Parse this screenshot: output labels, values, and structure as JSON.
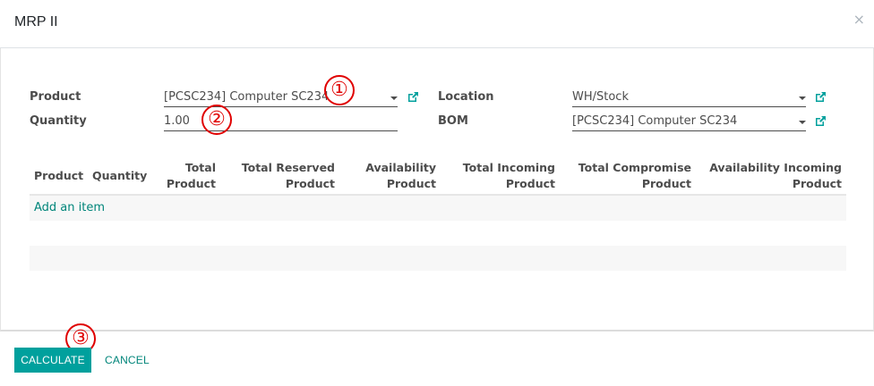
{
  "dialog": {
    "title": "MRP II",
    "close_glyph": "×"
  },
  "form": {
    "product_label": "Product",
    "product_value": "[PCSC234] Computer SC234",
    "quantity_label": "Quantity",
    "quantity_value": "1.00",
    "location_label": "Location",
    "location_value": "WH/Stock",
    "bom_label": "BOM",
    "bom_value": "[PCSC234] Computer SC234"
  },
  "table": {
    "columns": [
      {
        "line1": "Product",
        "line2": ""
      },
      {
        "line1": "Quantity",
        "line2": ""
      },
      {
        "line1": "Total",
        "line2": "Product"
      },
      {
        "line1": "Total Reserved",
        "line2": "Product"
      },
      {
        "line1": "Availability",
        "line2": "Product"
      },
      {
        "line1": "Total Incoming",
        "line2": "Product"
      },
      {
        "line1": "Total Compromise",
        "line2": "Product"
      },
      {
        "line1": "Availability Incoming",
        "line2": "Product"
      }
    ],
    "add_item_label": "Add an item"
  },
  "footer": {
    "calculate_label": "CALCULATE",
    "cancel_label": "CANCEL"
  },
  "annotations": [
    "①",
    "②",
    "③"
  ],
  "colors": {
    "accent": "#00a09d",
    "link": "#00857a",
    "annotation": "#e00000"
  },
  "icons": {
    "external_link": "external-link-icon",
    "dropdown": "caret-down-icon",
    "close": "close-icon"
  }
}
